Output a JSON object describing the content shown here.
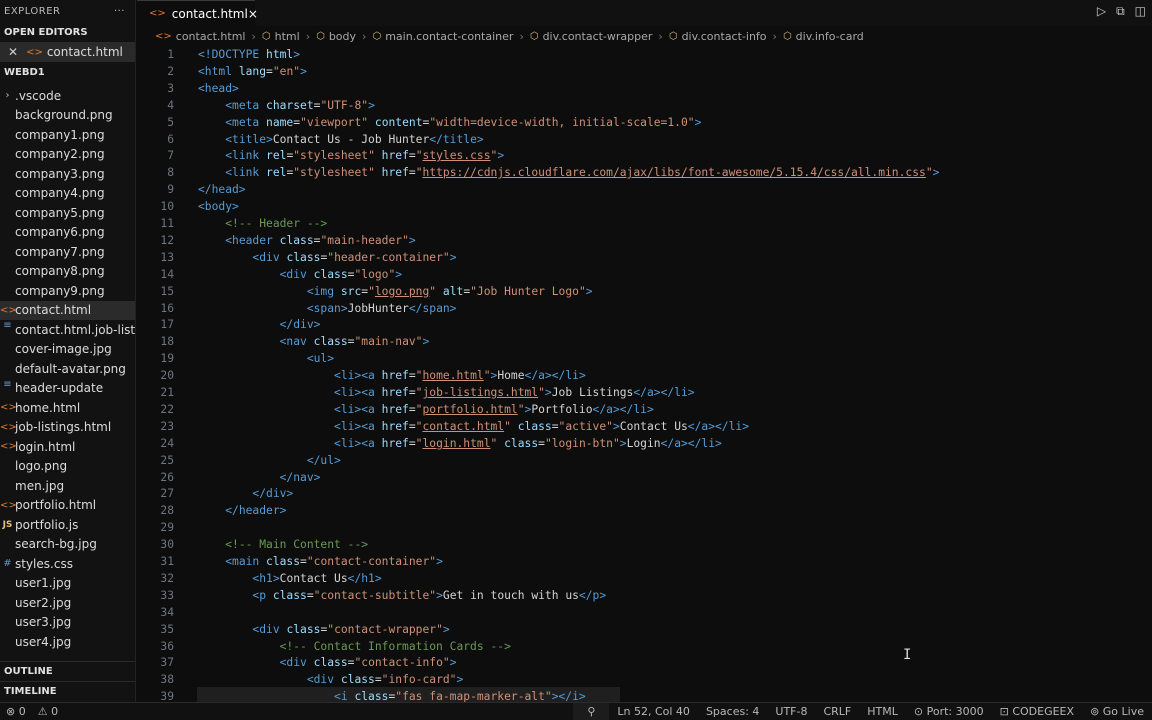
{
  "sidebar": {
    "explorer_label": "EXPLORER",
    "more_icon": "ellipsis-icon",
    "open_editors_label": "OPEN EDITORS",
    "open_file": "contact.html",
    "workspace_label": "WEBD1",
    "files": [
      {
        "name": ".vscode",
        "icon": "folder"
      },
      {
        "name": "background.png",
        "icon": "image"
      },
      {
        "name": "company1.png",
        "icon": "image"
      },
      {
        "name": "company2.png",
        "icon": "image"
      },
      {
        "name": "company3.png",
        "icon": "image"
      },
      {
        "name": "company4.png",
        "icon": "image"
      },
      {
        "name": "company5.png",
        "icon": "image"
      },
      {
        "name": "company6.png",
        "icon": "image"
      },
      {
        "name": "company7.png",
        "icon": "image"
      },
      {
        "name": "company8.png",
        "icon": "image"
      },
      {
        "name": "company9.png",
        "icon": "image"
      },
      {
        "name": "contact.html",
        "icon": "html"
      },
      {
        "name": "contact.html.job-listin...",
        "icon": "file"
      },
      {
        "name": "cover-image.jpg",
        "icon": "image"
      },
      {
        "name": "default-avatar.png",
        "icon": "image"
      },
      {
        "name": "header-update",
        "icon": "file"
      },
      {
        "name": "home.html",
        "icon": "html"
      },
      {
        "name": "job-listings.html",
        "icon": "html"
      },
      {
        "name": "login.html",
        "icon": "html"
      },
      {
        "name": "logo.png",
        "icon": "image"
      },
      {
        "name": "men.jpg",
        "icon": "image"
      },
      {
        "name": "portfolio.html",
        "icon": "html"
      },
      {
        "name": "portfolio.js",
        "icon": "js"
      },
      {
        "name": "search-bg.jpg",
        "icon": "image"
      },
      {
        "name": "styles.css",
        "icon": "css"
      },
      {
        "name": "user1.jpg",
        "icon": "image"
      },
      {
        "name": "user2.jpg",
        "icon": "image"
      },
      {
        "name": "user3.jpg",
        "icon": "image"
      },
      {
        "name": "user4.jpg",
        "icon": "image"
      }
    ],
    "outline_label": "OUTLINE",
    "timeline_label": "TIMELINE"
  },
  "tab": {
    "label": "contact.html",
    "close": "×"
  },
  "breadcrumb": [
    "contact.html",
    "html",
    "body",
    "main.contact-container",
    "div.contact-wrapper",
    "div.contact-info",
    "div.info-card"
  ],
  "code_lines": [
    [
      [
        "t",
        "<!DOCTYPE "
      ],
      [
        "a",
        "html"
      ],
      [
        "t",
        ">"
      ]
    ],
    [
      [
        "t",
        "<html "
      ],
      [
        "a",
        "lang"
      ],
      [
        "tx",
        "="
      ],
      [
        "s",
        "\"en\""
      ],
      [
        "t",
        ">"
      ]
    ],
    [
      [
        "t",
        "<head>"
      ]
    ],
    [
      [
        "tx",
        "    "
      ],
      [
        "t",
        "<meta "
      ],
      [
        "a",
        "charset"
      ],
      [
        "tx",
        "="
      ],
      [
        "s",
        "\"UTF-8\""
      ],
      [
        "t",
        ">"
      ]
    ],
    [
      [
        "tx",
        "    "
      ],
      [
        "t",
        "<meta "
      ],
      [
        "a",
        "name"
      ],
      [
        "tx",
        "="
      ],
      [
        "s",
        "\"viewport\" "
      ],
      [
        "a",
        "content"
      ],
      [
        "tx",
        "="
      ],
      [
        "s",
        "\"width=device-width, initial-scale=1.0\""
      ],
      [
        "t",
        ">"
      ]
    ],
    [
      [
        "tx",
        "    "
      ],
      [
        "t",
        "<title>"
      ],
      [
        "tx",
        "Contact Us - Job Hunter"
      ],
      [
        "t",
        "</title>"
      ]
    ],
    [
      [
        "tx",
        "    "
      ],
      [
        "t",
        "<link "
      ],
      [
        "a",
        "rel"
      ],
      [
        "tx",
        "="
      ],
      [
        "s",
        "\"stylesheet\" "
      ],
      [
        "a",
        "href"
      ],
      [
        "tx",
        "="
      ],
      [
        "s",
        "\""
      ],
      [
        "u",
        "styles.css"
      ],
      [
        "s",
        "\""
      ],
      [
        "t",
        ">"
      ]
    ],
    [
      [
        "tx",
        "    "
      ],
      [
        "t",
        "<link "
      ],
      [
        "a",
        "rel"
      ],
      [
        "tx",
        "="
      ],
      [
        "s",
        "\"stylesheet\" "
      ],
      [
        "a",
        "href"
      ],
      [
        "tx",
        "="
      ],
      [
        "s",
        "\""
      ],
      [
        "u",
        "https://cdnjs.cloudflare.com/ajax/libs/font-awesome/5.15.4/css/all.min.css"
      ],
      [
        "s",
        "\""
      ],
      [
        "t",
        ">"
      ]
    ],
    [
      [
        "t",
        "</head>"
      ]
    ],
    [
      [
        "t",
        "<body>"
      ]
    ],
    [
      [
        "tx",
        "    "
      ],
      [
        "c",
        "<!-- Header -->"
      ]
    ],
    [
      [
        "tx",
        "    "
      ],
      [
        "t",
        "<header "
      ],
      [
        "a",
        "class"
      ],
      [
        "tx",
        "="
      ],
      [
        "s",
        "\"main-header\""
      ],
      [
        "t",
        ">"
      ]
    ],
    [
      [
        "tx",
        "        "
      ],
      [
        "t",
        "<div "
      ],
      [
        "a",
        "class"
      ],
      [
        "tx",
        "="
      ],
      [
        "s",
        "\"header-container\""
      ],
      [
        "t",
        ">"
      ]
    ],
    [
      [
        "tx",
        "            "
      ],
      [
        "t",
        "<div "
      ],
      [
        "a",
        "class"
      ],
      [
        "tx",
        "="
      ],
      [
        "s",
        "\"logo\""
      ],
      [
        "t",
        ">"
      ]
    ],
    [
      [
        "tx",
        "                "
      ],
      [
        "t",
        "<img "
      ],
      [
        "a",
        "src"
      ],
      [
        "tx",
        "="
      ],
      [
        "s",
        "\""
      ],
      [
        "u",
        "logo.png"
      ],
      [
        "s",
        "\" "
      ],
      [
        "a",
        "alt"
      ],
      [
        "tx",
        "="
      ],
      [
        "s",
        "\"Job Hunter Logo\""
      ],
      [
        "t",
        ">"
      ]
    ],
    [
      [
        "tx",
        "                "
      ],
      [
        "t",
        "<span>"
      ],
      [
        "tx",
        "JobHunter"
      ],
      [
        "t",
        "</span>"
      ]
    ],
    [
      [
        "tx",
        "            "
      ],
      [
        "t",
        "</div>"
      ]
    ],
    [
      [
        "tx",
        "            "
      ],
      [
        "t",
        "<nav "
      ],
      [
        "a",
        "class"
      ],
      [
        "tx",
        "="
      ],
      [
        "s",
        "\"main-nav\""
      ],
      [
        "t",
        ">"
      ]
    ],
    [
      [
        "tx",
        "                "
      ],
      [
        "t",
        "<ul>"
      ]
    ],
    [
      [
        "tx",
        "                    "
      ],
      [
        "t",
        "<li><a "
      ],
      [
        "a",
        "href"
      ],
      [
        "tx",
        "="
      ],
      [
        "s",
        "\""
      ],
      [
        "u",
        "home.html"
      ],
      [
        "s",
        "\""
      ],
      [
        "t",
        ">"
      ],
      [
        "tx",
        "Home"
      ],
      [
        "t",
        "</a></li>"
      ]
    ],
    [
      [
        "tx",
        "                    "
      ],
      [
        "t",
        "<li><a "
      ],
      [
        "a",
        "href"
      ],
      [
        "tx",
        "="
      ],
      [
        "s",
        "\""
      ],
      [
        "u",
        "job-listings.html"
      ],
      [
        "s",
        "\""
      ],
      [
        "t",
        ">"
      ],
      [
        "tx",
        "Job Listings"
      ],
      [
        "t",
        "</a></li>"
      ]
    ],
    [
      [
        "tx",
        "                    "
      ],
      [
        "t",
        "<li><a "
      ],
      [
        "a",
        "href"
      ],
      [
        "tx",
        "="
      ],
      [
        "s",
        "\""
      ],
      [
        "u",
        "portfolio.html"
      ],
      [
        "s",
        "\""
      ],
      [
        "t",
        ">"
      ],
      [
        "tx",
        "Portfolio"
      ],
      [
        "t",
        "</a></li>"
      ]
    ],
    [
      [
        "tx",
        "                    "
      ],
      [
        "t",
        "<li><a "
      ],
      [
        "a",
        "href"
      ],
      [
        "tx",
        "="
      ],
      [
        "s",
        "\""
      ],
      [
        "u",
        "contact.html"
      ],
      [
        "s",
        "\" "
      ],
      [
        "a",
        "class"
      ],
      [
        "tx",
        "="
      ],
      [
        "s",
        "\"active\""
      ],
      [
        "t",
        ">"
      ],
      [
        "tx",
        "Contact Us"
      ],
      [
        "t",
        "</a></li>"
      ]
    ],
    [
      [
        "tx",
        "                    "
      ],
      [
        "t",
        "<li><a "
      ],
      [
        "a",
        "href"
      ],
      [
        "tx",
        "="
      ],
      [
        "s",
        "\""
      ],
      [
        "u",
        "login.html"
      ],
      [
        "s",
        "\" "
      ],
      [
        "a",
        "class"
      ],
      [
        "tx",
        "="
      ],
      [
        "s",
        "\"login-btn\""
      ],
      [
        "t",
        ">"
      ],
      [
        "tx",
        "Login"
      ],
      [
        "t",
        "</a></li>"
      ]
    ],
    [
      [
        "tx",
        "                "
      ],
      [
        "t",
        "</ul>"
      ]
    ],
    [
      [
        "tx",
        "            "
      ],
      [
        "t",
        "</nav>"
      ]
    ],
    [
      [
        "tx",
        "        "
      ],
      [
        "t",
        "</div>"
      ]
    ],
    [
      [
        "tx",
        "    "
      ],
      [
        "t",
        "</header>"
      ]
    ],
    [],
    [
      [
        "tx",
        "    "
      ],
      [
        "c",
        "<!-- Main Content -->"
      ]
    ],
    [
      [
        "tx",
        "    "
      ],
      [
        "t",
        "<main "
      ],
      [
        "a",
        "class"
      ],
      [
        "tx",
        "="
      ],
      [
        "s",
        "\"contact-container\""
      ],
      [
        "t",
        ">"
      ]
    ],
    [
      [
        "tx",
        "        "
      ],
      [
        "t",
        "<h1>"
      ],
      [
        "tx",
        "Contact Us"
      ],
      [
        "t",
        "</h1>"
      ]
    ],
    [
      [
        "tx",
        "        "
      ],
      [
        "t",
        "<p "
      ],
      [
        "a",
        "class"
      ],
      [
        "tx",
        "="
      ],
      [
        "s",
        "\"contact-subtitle\""
      ],
      [
        "t",
        ">"
      ],
      [
        "tx",
        "Get in touch with us"
      ],
      [
        "t",
        "</p>"
      ]
    ],
    [],
    [
      [
        "tx",
        "        "
      ],
      [
        "t",
        "<div "
      ],
      [
        "a",
        "class"
      ],
      [
        "tx",
        "="
      ],
      [
        "s",
        "\"contact-wrapper\""
      ],
      [
        "t",
        ">"
      ]
    ],
    [
      [
        "tx",
        "            "
      ],
      [
        "c",
        "<!-- Contact Information Cards -->"
      ]
    ],
    [
      [
        "tx",
        "            "
      ],
      [
        "t",
        "<div "
      ],
      [
        "a",
        "class"
      ],
      [
        "tx",
        "="
      ],
      [
        "s",
        "\"contact-info\""
      ],
      [
        "t",
        ">"
      ]
    ],
    [
      [
        "tx",
        "                "
      ],
      [
        "t",
        "<div "
      ],
      [
        "a",
        "class"
      ],
      [
        "tx",
        "="
      ],
      [
        "s",
        "\"info-card\""
      ],
      [
        "t",
        ">"
      ]
    ],
    [
      [
        "tx",
        "                    "
      ],
      [
        "t",
        "<i "
      ],
      [
        "a",
        "class"
      ],
      [
        "tx",
        "="
      ],
      [
        "s",
        "\"fas fa-map-marker-alt\""
      ],
      [
        "t",
        "></i>"
      ]
    ]
  ],
  "status": {
    "errors": "0",
    "warnings": "0",
    "zoom_icon": "zoom-icon",
    "position": "Ln 52, Col 40",
    "spaces": "Spaces: 4",
    "encoding": "UTF-8",
    "eol": "CRLF",
    "language": "HTML",
    "port": "Port: 3000",
    "codegeex": "CODEGEEX",
    "golive": "Go Live"
  }
}
